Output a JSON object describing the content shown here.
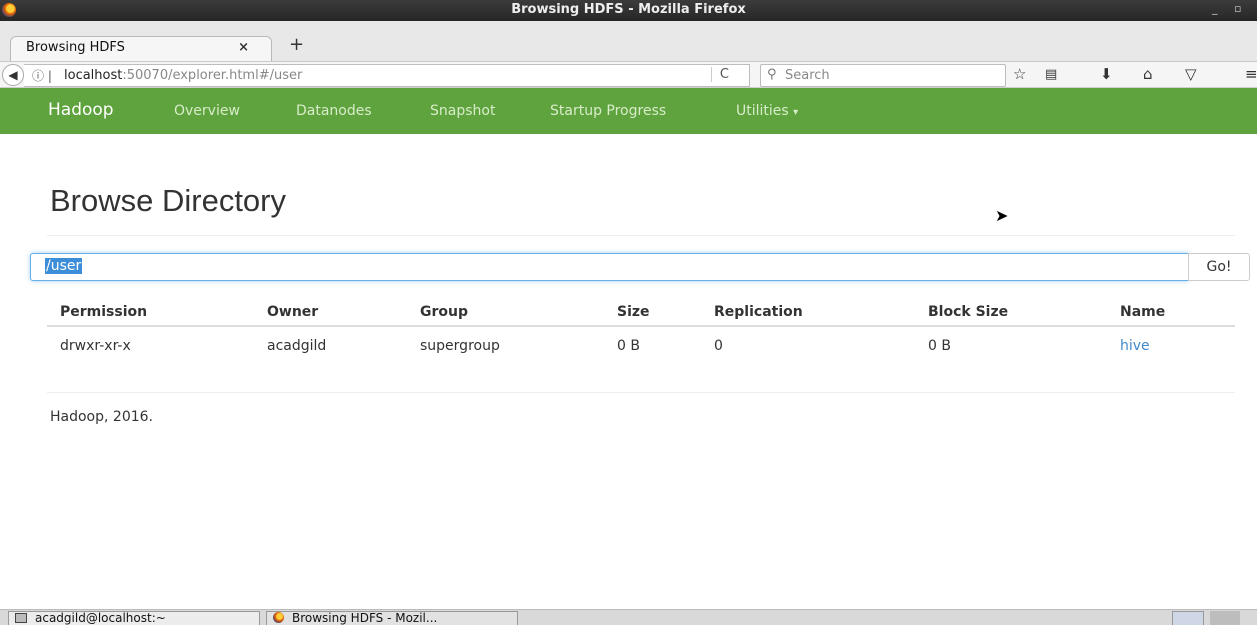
{
  "window": {
    "title": "Browsing HDFS - Mozilla Firefox",
    "minimize": "_",
    "maximize": "▫"
  },
  "tab": {
    "label": "Browsing HDFS",
    "close": "×",
    "new_tab": "+"
  },
  "urlbar": {
    "info_glyph": "ⓘ |",
    "host": "localhost",
    "rest": ":50070/explorer.html#/user",
    "reload_glyph": "C"
  },
  "search": {
    "placeholder": "Search",
    "icon": "search-icon"
  },
  "toolbar_icons": [
    "bookmark-star-icon",
    "reader-icon",
    "download-icon",
    "home-icon",
    "pocket-icon",
    "menu-icon"
  ],
  "nav": {
    "brand": "Hadoop",
    "items": [
      "Overview",
      "Datanodes",
      "Snapshot",
      "Startup Progress",
      "Utilities"
    ],
    "utilities_caret": "▾"
  },
  "page": {
    "title": "Browse Directory",
    "path_value": "/user",
    "go_label": "Go!",
    "footer": "Hadoop, 2016."
  },
  "table": {
    "headers": [
      "Permission",
      "Owner",
      "Group",
      "Size",
      "Replication",
      "Block Size",
      "Name"
    ],
    "rows": [
      [
        "drwxr-xr-x",
        "acadgild",
        "supergroup",
        "0 B",
        "0",
        "0 B",
        "hive"
      ]
    ]
  },
  "taskbar": {
    "tasks": [
      "acadgild@localhost:~",
      "Browsing HDFS - Mozil..."
    ]
  },
  "colors": {
    "nav_green": "#5fa33e",
    "link": "#428bca",
    "selection": "#3d8ed8"
  }
}
